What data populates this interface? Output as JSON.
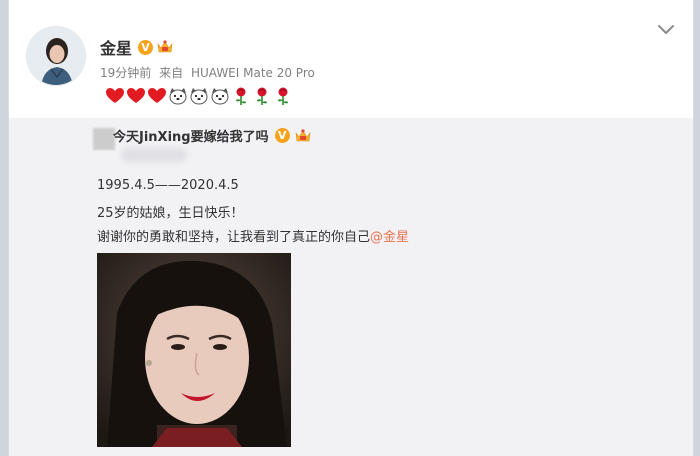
{
  "post": {
    "author": "金星",
    "verified_badge": "V",
    "time": "19分钟前",
    "source_prefix": "来自",
    "device": "HUAWEI Mate 20 Pro",
    "emoji_icons": [
      "heart-icon",
      "heart-icon",
      "heart-icon",
      "dog-face-icon",
      "dog-face-icon",
      "dog-face-icon",
      "rose-icon",
      "rose-icon",
      "rose-icon"
    ]
  },
  "repost": {
    "author": "今天JinXing要嫁给我了吗",
    "verified_badge": "V",
    "line1": "1995.4.5——2020.4.5",
    "line2": "25岁的姑娘，生日快乐！",
    "line3_text": "谢谢你的勇敢和坚持，让我看到了真正的你自己",
    "line3_mention": "@金星"
  },
  "colors": {
    "accent": "#eb7350",
    "badge": "#f6a21b",
    "repost_bg": "#f2f2f5"
  }
}
